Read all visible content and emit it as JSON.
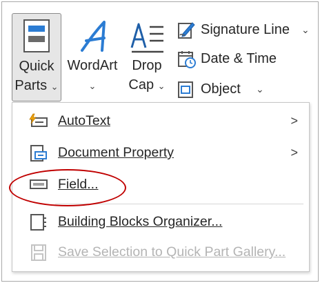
{
  "ribbon": {
    "quick_parts": {
      "line1": "Quick",
      "line2": "Parts",
      "chevron": "⌄",
      "icon": "quick-parts-icon"
    },
    "wordart": {
      "line1": "WordArt",
      "chevron": "⌄",
      "icon": "wordart-icon"
    },
    "drop_cap": {
      "line1": "Drop",
      "line2": "Cap",
      "chevron": "⌄",
      "icon": "drop-cap-icon"
    },
    "signature_line": {
      "label": "Signature Line",
      "chevron": "⌄",
      "icon": "signature-line-icon"
    },
    "date_time": {
      "label": "Date & Time",
      "icon": "calendar-clock-icon"
    },
    "object": {
      "label": "Object",
      "chevron": "⌄",
      "icon": "object-icon"
    }
  },
  "menu": {
    "items": [
      {
        "label": "AutoText",
        "arrow": ">",
        "icon": "autotext-icon",
        "enabled": true
      },
      {
        "label": "Document Property",
        "arrow": ">",
        "icon": "document-property-icon",
        "enabled": true
      },
      {
        "label": "Field...",
        "icon": "field-icon",
        "enabled": true,
        "highlighted": true
      },
      {
        "label": "Building Blocks Organizer...",
        "icon": "building-blocks-icon",
        "enabled": true
      },
      {
        "label": "Save Selection to Quick Part Gallery...",
        "icon": "save-selection-icon",
        "enabled": false
      }
    ]
  },
  "colors": {
    "accent_blue": "#2b7cd3",
    "dark_blue": "#1f5fa8",
    "highlight_red": "#c00000",
    "disabled_text": "#b4b4b4",
    "pressed_bg": "#e6e6e6"
  }
}
